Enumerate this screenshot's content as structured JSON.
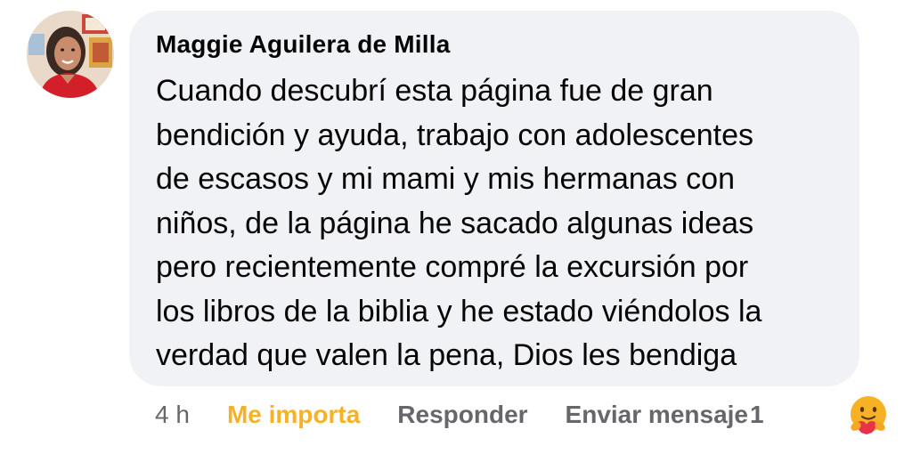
{
  "comment": {
    "author": "Maggie Aguilera de Milla",
    "lines": [
      "Cuando descubrí esta página fue de gran",
      "bendición y ayuda, trabajo con adolescentes",
      "de escasos y mi mami y mis hermanas con",
      "niños, de la página he sacado algunas ideas",
      "pero recientemente compré la excursión por",
      "los libros de la biblia y he estado viéndolos la",
      "verdad que valen la pena, Dios les bendiga"
    ]
  },
  "actions": {
    "timestamp": "4 h",
    "reaction_label": "Me importa",
    "reply_label": "Responder",
    "message_label": "Enviar mensaje",
    "reaction_count": "1",
    "reaction_icon": "care-hug-emoji-icon"
  },
  "colors": {
    "bubble": "#f0f2f5",
    "text": "#050505",
    "meta": "#65676b",
    "care_reaction": "#f7b125"
  }
}
